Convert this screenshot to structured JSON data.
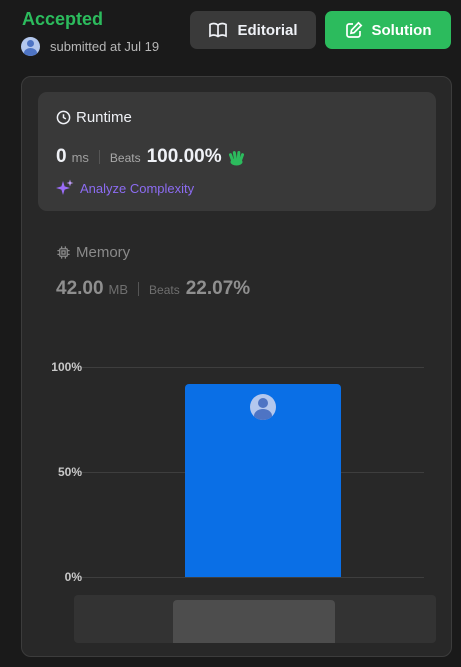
{
  "header": {
    "status": "Accepted",
    "submitted_text": "submitted at Jul 19",
    "editorial_label": "Editorial",
    "solution_label": "Solution"
  },
  "runtime": {
    "title": "Runtime",
    "value": "0",
    "unit": "ms",
    "beats_label": "Beats",
    "beats_value": "100.00%",
    "analyze_label": "Analyze Complexity"
  },
  "memory": {
    "title": "Memory",
    "value": "42.00",
    "unit": "MB",
    "beats_label": "Beats",
    "beats_value": "22.07%"
  },
  "colors": {
    "accepted": "#2cbb5d",
    "solution_button": "#2cbb5d",
    "bar": "#0a6fe6",
    "analyze": "#8c6cf2",
    "clap_icon": "#2cbb5d"
  },
  "icons": {
    "editorial": "book-open-icon",
    "solution": "edit-icon",
    "runtime": "clock-icon",
    "memory": "chip-icon",
    "analyze": "sparkle-icon",
    "beats_runtime": "clapping-hands-icon"
  },
  "chart_data": {
    "type": "bar",
    "categories": [
      ""
    ],
    "values": [
      92
    ],
    "yticks": [
      "100%",
      "50%",
      "0%"
    ],
    "ylim": [
      0,
      100
    ],
    "grid": true
  }
}
